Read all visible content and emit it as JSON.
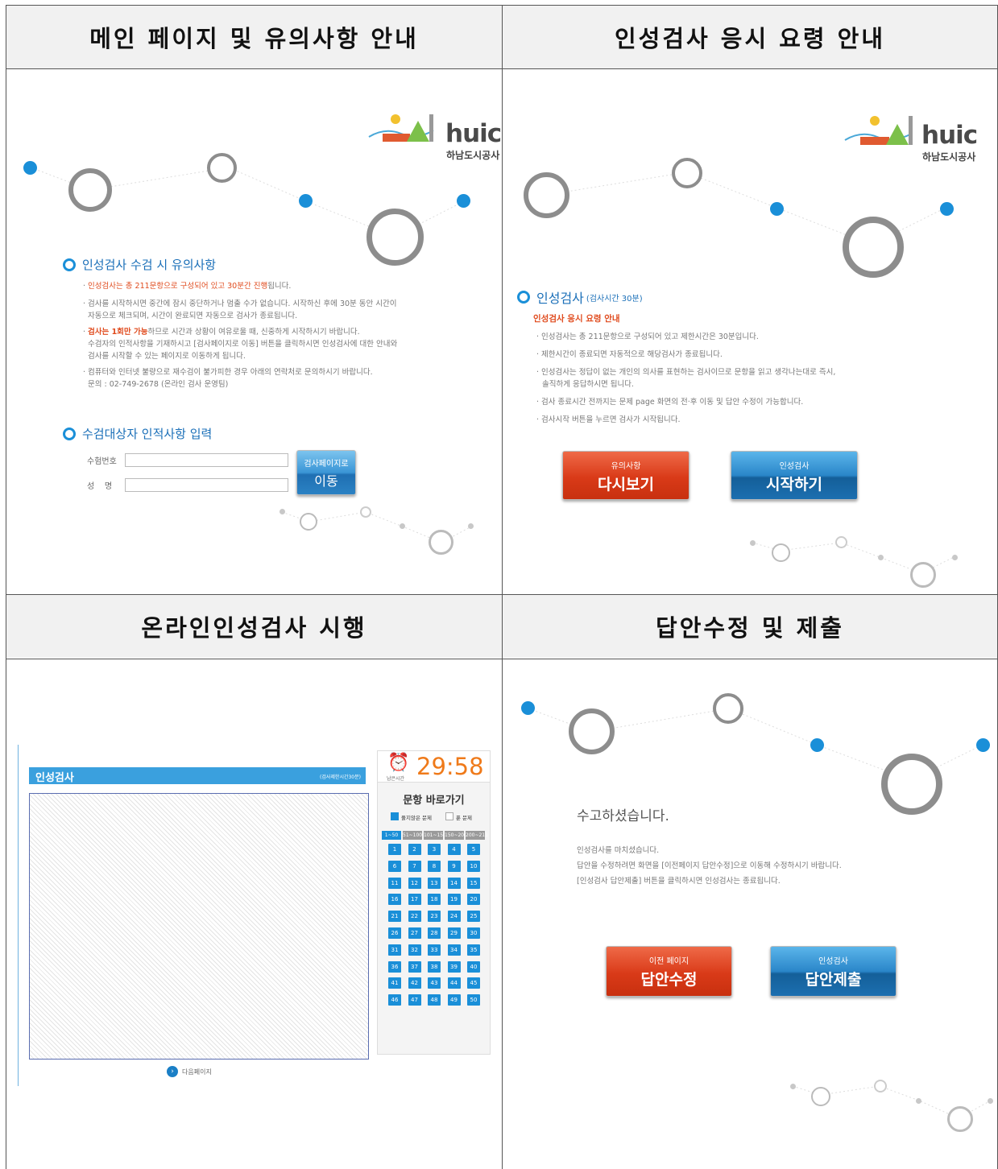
{
  "headers": {
    "q1": "메인 페이지 및 유의사항 안내",
    "q2": "인성검사 응시 요령 안내",
    "q3": "온라인인성검사 시행",
    "q4": "답안수정 및 제출"
  },
  "logo": {
    "word": "huic",
    "sub": "하남도시공사"
  },
  "panel1": {
    "notice_title": "인성검사 수검 시 유의사항",
    "n1_red": "인성검사는 총 211문항으로 구성되어 있고 30분간 진행",
    "n1_rest": "됩니다.",
    "n2a": "검사를 시작하시면 중간에 잠시 중단하거나 멈출 수가 없습니다. 시작하신 후에 30분 동안 시간이",
    "n2b": "자동으로 체크되며, 시간이 완료되면 자동으로 검사가 종료됩니다.",
    "n3_red": "검사는 1회만 가능",
    "n3_rest": "하므로 시간과 상황이 여유로울 때, 신중하게 시작하시기 바랍니다.",
    "n3b": "수검자의 인적사항을 기재하시고 [검사페이지로 이동] 버튼을 클릭하시면 인성검사에 대한 안내와",
    "n3c": "검사를 시작할 수 있는 페이지로 이동하게 됩니다.",
    "n4a": "컴퓨터와 인터넷 불량으로 재수검이 불가피한 경우 아래의 연락처로 문의하시기 바랍니다.",
    "n4b": "문의 : 02-749-2678 (온라인 검사 운영팀)",
    "input_title": "수검대상자 인적사항 입력",
    "label_id": "수험번호",
    "label_name": "성    명",
    "btn_small": "검사페이지로",
    "btn_big": "이동"
  },
  "panel2": {
    "title": "인성검사",
    "title_sub": "(검사시간 30분)",
    "guide_title": "인성검사 응시 요령 안내",
    "g1": "인성검사는 총 211문항으로 구성되어 있고 제한시간은 30분입니다.",
    "g2": "제한시간이 종료되면 자동적으로 해당검사가 종료됩니다.",
    "g3a": "인성검사는 정답이 없는 개인의 의사를 표현하는 검사이므로 문항을 읽고 생각나는대로 즉시,",
    "g3b": "솔직하게 응답하시면 됩니다.",
    "g4": "검사 종료시간 전까지는 문제 page 화면의 전·후 이동 및 답안 수정이 가능합니다.",
    "g5": "검사시작 버튼을 누르면 검사가 시작됩니다.",
    "btn_red_small": "유의사항",
    "btn_red_big": "다시보기",
    "btn_blue_small": "인성검사",
    "btn_blue_big": "시작하기"
  },
  "panel3": {
    "bar_title": "인성검사",
    "bar_sub": "(검사제한시간30분)",
    "timer": "29:58",
    "timer_label": "남은시간",
    "nav_title": "문항 바로가기",
    "legend_unanswered": "풀지않은 문제",
    "legend_answered": "푼 문제",
    "tabs": [
      "1~50",
      "51~100",
      "101~150",
      "150~200",
      "200~211"
    ],
    "questions": [
      "1",
      "2",
      "3",
      "4",
      "5",
      "6",
      "7",
      "8",
      "9",
      "10",
      "11",
      "12",
      "13",
      "14",
      "15",
      "16",
      "17",
      "18",
      "19",
      "20",
      "21",
      "22",
      "23",
      "24",
      "25",
      "26",
      "27",
      "28",
      "29",
      "30",
      "31",
      "32",
      "33",
      "34",
      "35",
      "36",
      "37",
      "38",
      "39",
      "40",
      "41",
      "42",
      "43",
      "44",
      "45",
      "46",
      "47",
      "48",
      "49",
      "50"
    ],
    "next": "다음페이지"
  },
  "panel4": {
    "done_title": "수고하셨습니다.",
    "d1": "인성검사를 마치셨습니다.",
    "d2": "답안을 수정하려면 화면을 [이전페이지 답안수정]으로 이동해 수정하시기 바랍니다.",
    "d3": "[인성검사 답안제출] 버튼을 클릭하시면 인성검사는 종료됩니다.",
    "btn_red_small": "이전 페이지",
    "btn_red_big": "답안수정",
    "btn_blue_small": "인성검사",
    "btn_blue_big": "답안제출"
  },
  "colors": {
    "accent": "#1a8fd8",
    "red": "#e04b1e",
    "ring": "#8d8d8d"
  }
}
